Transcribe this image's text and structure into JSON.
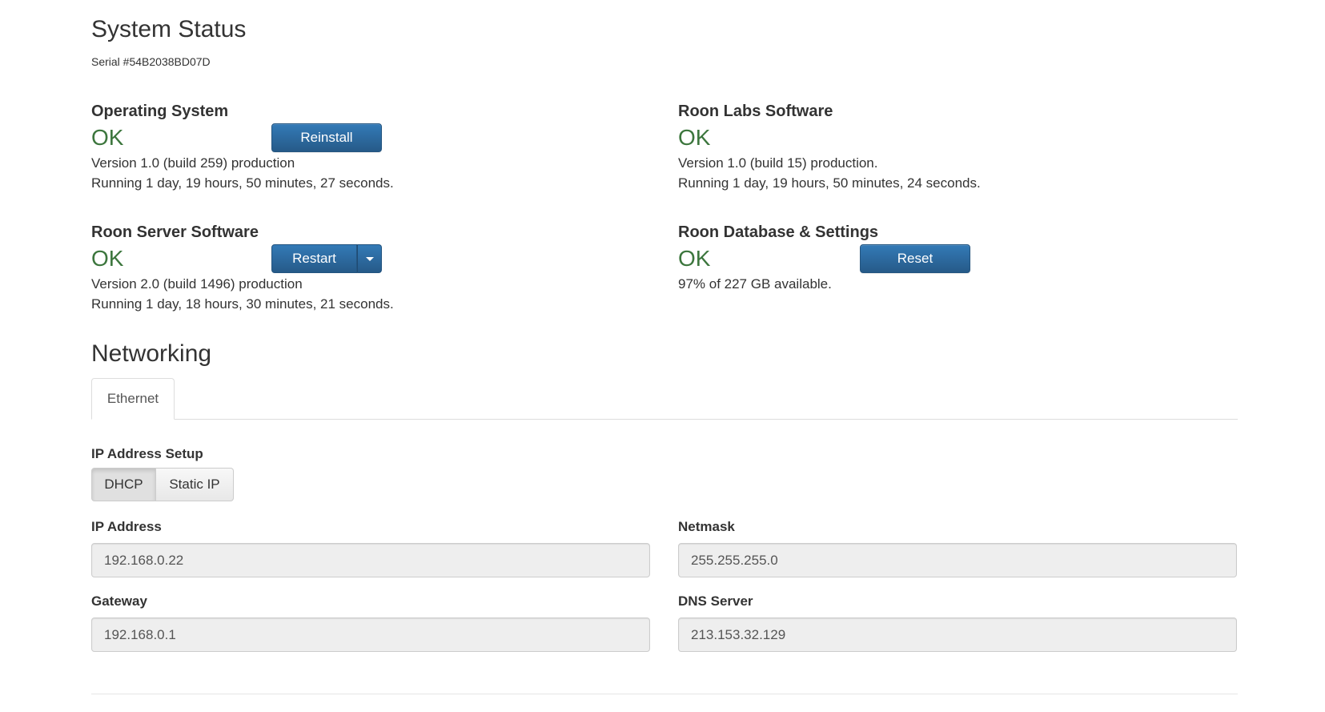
{
  "header": {
    "title": "System Status",
    "serial": "Serial #54B2038BD07D"
  },
  "status": {
    "operating_system": {
      "heading": "Operating System",
      "state": "OK",
      "button_label": "Reinstall",
      "version": "Version 1.0 (build 259) production",
      "uptime": "Running 1 day, 19 hours, 50 minutes, 27 seconds."
    },
    "roon_labs_software": {
      "heading": "Roon Labs Software",
      "state": "OK",
      "version": "Version 1.0 (build 15) production.",
      "uptime": "Running 1 day, 19 hours, 50 minutes, 24 seconds."
    },
    "roon_server_software": {
      "heading": "Roon Server Software",
      "state": "OK",
      "button_label": "Restart",
      "dropdown_icon": "caret-down-icon",
      "version": "Version 2.0 (build 1496) production",
      "uptime": "Running 1 day, 18 hours, 30 minutes, 21 seconds."
    },
    "roon_database": {
      "heading": "Roon Database & Settings",
      "state": "OK",
      "button_label": "Reset",
      "storage": "97% of 227 GB available."
    }
  },
  "networking": {
    "title": "Networking",
    "tabs": [
      {
        "label": "Ethernet",
        "active": true
      }
    ],
    "ip_setup": {
      "label": "IP Address Setup",
      "options": [
        "DHCP",
        "Static IP"
      ],
      "selected": "DHCP"
    },
    "fields": {
      "ip_address": {
        "label": "IP Address",
        "value": "192.168.0.22"
      },
      "netmask": {
        "label": "Netmask",
        "value": "255.255.255.0"
      },
      "gateway": {
        "label": "Gateway",
        "value": "192.168.0.1"
      },
      "dns_server": {
        "label": "DNS Server",
        "value": "213.153.32.129"
      }
    }
  },
  "colors": {
    "ok_green": "#3c763d",
    "primary_blue": "#337ab7",
    "text": "#333333"
  }
}
